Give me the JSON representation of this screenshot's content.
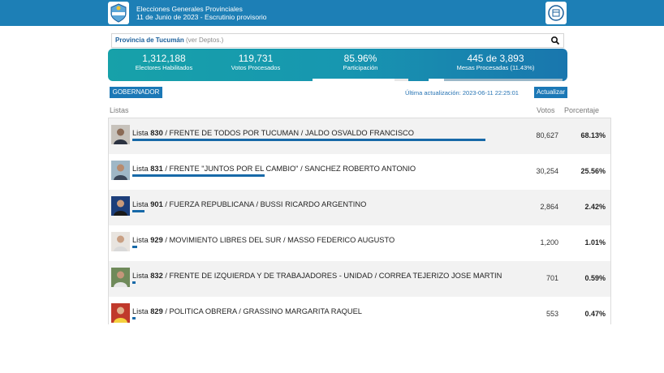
{
  "header": {
    "title_line1": "Elecciones Generales Provinciales",
    "title_line2": "11 de Junio de 2023 - Escrutinio provisorio"
  },
  "search": {
    "province": "Provincia de Tucumán",
    "sub": "(ver Deptos.)"
  },
  "stats": {
    "electores_value": "1,312,188",
    "electores_label": "Electores Habilitados",
    "votos_value": "119,731",
    "votos_label": "Votos Procesados",
    "participacion_value": "85.96%",
    "participacion_label": "Participación",
    "participacion_fraction": 0.8596,
    "mesas_value": "445 de 3,893",
    "mesas_label": "Mesas Procesadas (11.43%)",
    "mesas_fraction": 0.1143
  },
  "toolbar": {
    "category_label": "GOBERNADOR",
    "last_update": "Última actualización: 2023-06-11 22:25:01",
    "update_label": "Actualizar"
  },
  "table": {
    "col_listas": "Listas",
    "col_votos": "Votos",
    "col_porcentaje": "Porcentaje",
    "rows": [
      {
        "prefix": "Lista ",
        "num": "830",
        "text": " / FRENTE DE TODOS POR TUCUMAN / JALDO OSVALDO FRANCISCO",
        "votes": "80,627",
        "pct": "68.13%",
        "share": 0.6813
      },
      {
        "prefix": "Lista ",
        "num": "831",
        "text": " / FRENTE \"JUNTOS POR EL CAMBIO\" / SANCHEZ ROBERTO ANTONIO",
        "votes": "30,254",
        "pct": "25.56%",
        "share": 0.2556
      },
      {
        "prefix": "Lista ",
        "num": "901",
        "text": " / FUERZA REPUBLICANA / BUSSI RICARDO ARGENTINO",
        "votes": "2,864",
        "pct": "2.42%",
        "share": 0.0242
      },
      {
        "prefix": "Lista ",
        "num": "929",
        "text": " / MOVIMIENTO LIBRES DEL SUR / MASSO FEDERICO AUGUSTO",
        "votes": "1,200",
        "pct": "1.01%",
        "share": 0.0101
      },
      {
        "prefix": "Lista ",
        "num": "832",
        "text": " / FRENTE DE IZQUIERDA Y DE TRABAJADORES - UNIDAD / CORREA TEJERIZO JOSE MARTIN",
        "votes": "701",
        "pct": "0.59%",
        "share": 0.0059
      },
      {
        "prefix": "Lista ",
        "num": "829",
        "text": " / POLITICA OBRERA / GRASSINO MARGARITA RAQUEL",
        "votes": "553",
        "pct": "0.47%",
        "share": 0.0047
      }
    ]
  },
  "colors": {
    "topbar": "#1d7fb6",
    "accent": "#1b78b6",
    "bar": "#1769a8"
  }
}
